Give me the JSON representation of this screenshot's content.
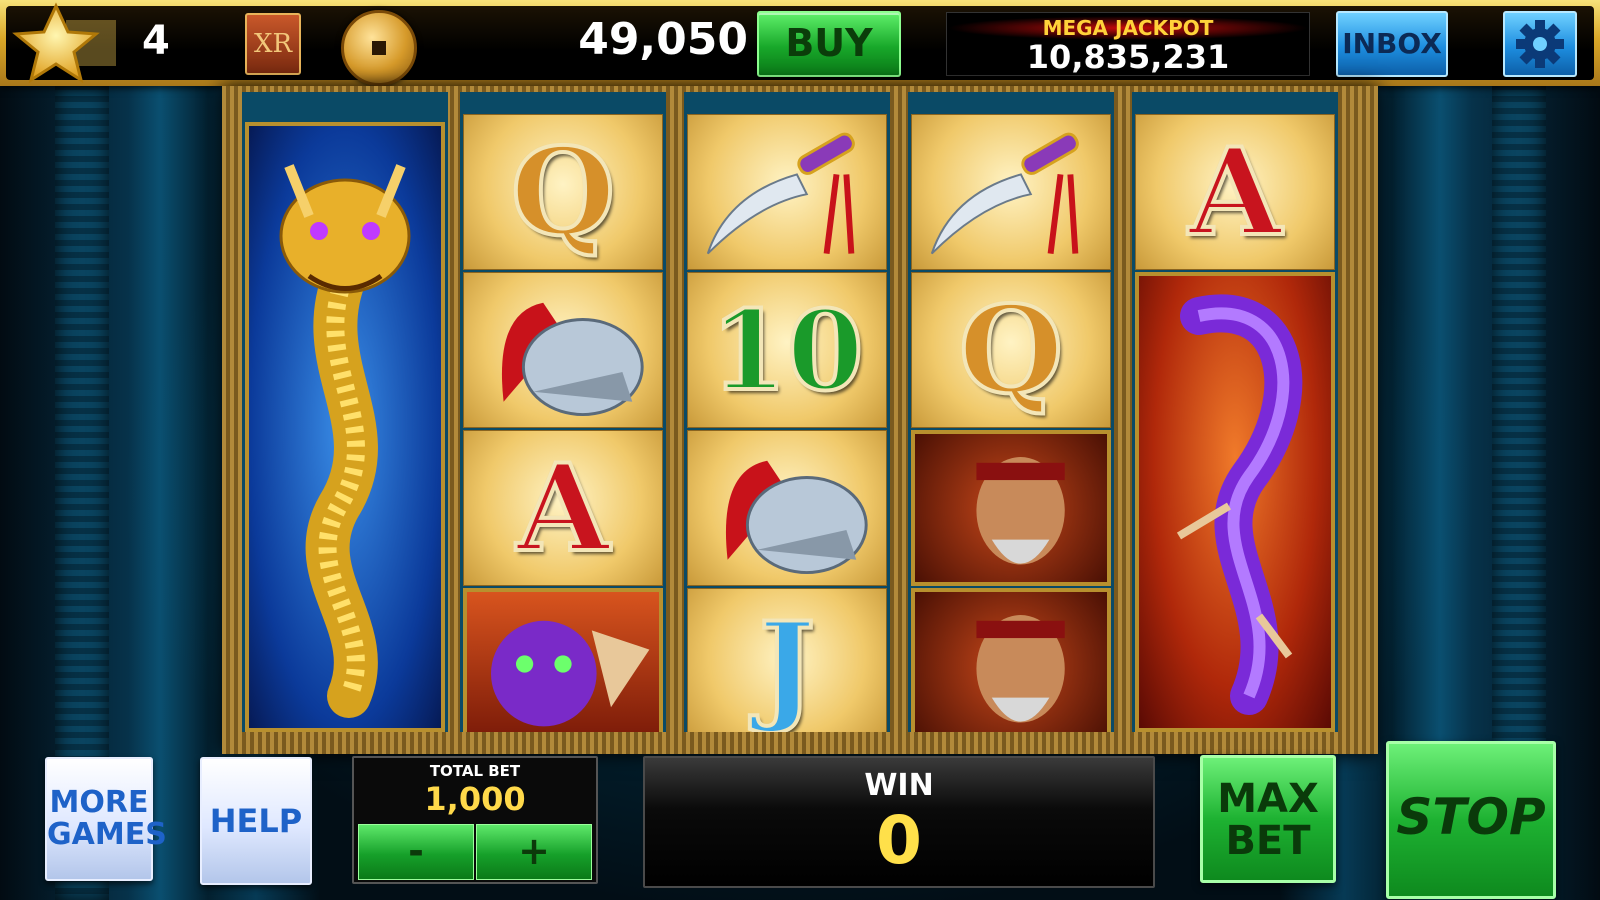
{
  "header": {
    "level": "4",
    "xr_badge": "XR",
    "coin_balance": "49,050",
    "buy_label": "BUY",
    "jackpot_label": "MEGA JACKPOT",
    "jackpot_value": "10,835,231",
    "inbox_label": "INBOX"
  },
  "reels": {
    "reel2": [
      "Q",
      "helmet",
      "A",
      "purple-dragon-face"
    ],
    "reel3": [
      "dagger",
      "10",
      "helmet",
      "J"
    ],
    "reel4": [
      "dagger",
      "Q",
      "warrior",
      "warrior"
    ],
    "reel5": [
      "A",
      "purple-dragon"
    ],
    "reel1": [
      "gold-dragon"
    ]
  },
  "symbols": {
    "q": "Q",
    "a": "A",
    "ten": "10",
    "j": "J"
  },
  "controls": {
    "more_games_line1": "MORE",
    "more_games_line2": "GAMES",
    "help_label": "HELP",
    "total_bet_label": "TOTAL BET",
    "total_bet_value": "1,000",
    "minus_label": "-",
    "plus_label": "+",
    "win_label": "WIN",
    "win_value": "0",
    "max_bet_line1": "MAX",
    "max_bet_line2": "BET",
    "stop_label": "STOP"
  },
  "colors": {
    "gold_frame": "#d9a728",
    "buy_green": "#18a82a",
    "inbox_blue": "#1d8ee0",
    "jackpot_red": "#c60a0a",
    "win_yellow": "#ffe04a"
  }
}
